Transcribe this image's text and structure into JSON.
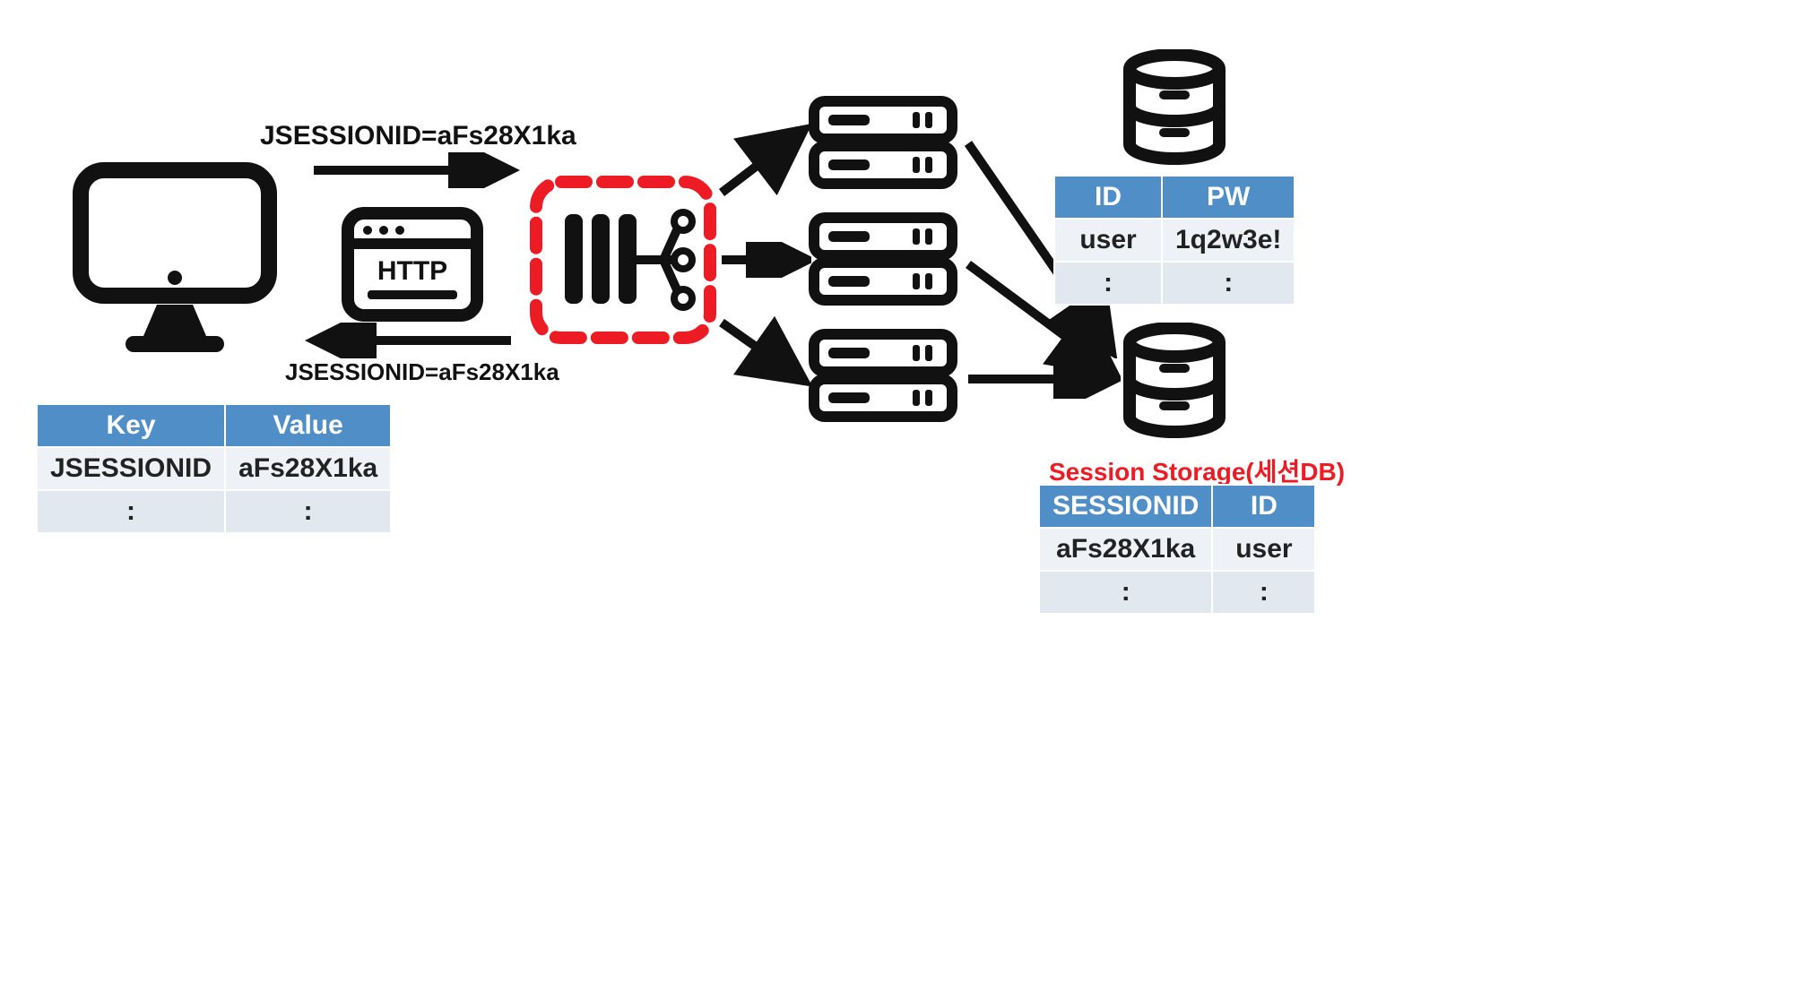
{
  "labels": {
    "request": "JSESSIONID=aFs28X1ka",
    "response": "JSESSIONID=aFs28X1ka",
    "sessionStorage": "Session Storage(세션DB)"
  },
  "clientTable": {
    "headers": [
      "Key",
      "Value"
    ],
    "rows": [
      [
        "JSESSIONID",
        "aFs28X1ka"
      ],
      [
        ":",
        ":"
      ]
    ]
  },
  "userTable": {
    "headers": [
      "ID",
      "PW"
    ],
    "rows": [
      [
        "user",
        "1q2w3e!"
      ],
      [
        ":",
        ":"
      ]
    ]
  },
  "sessionTable": {
    "headers": [
      "SESSIONID",
      "ID"
    ],
    "rows": [
      [
        "aFs28X1ka",
        "user"
      ],
      [
        ":",
        ":"
      ]
    ]
  },
  "icons": {
    "monitor": "monitor-icon",
    "http": "http-icon",
    "loadBalancer": "load-balancer-icon",
    "server": "server-icon",
    "database": "database-icon"
  },
  "colors": {
    "tableHeader": "#4f8ec6",
    "highlight": "#ed1c24",
    "ink": "#111111"
  }
}
